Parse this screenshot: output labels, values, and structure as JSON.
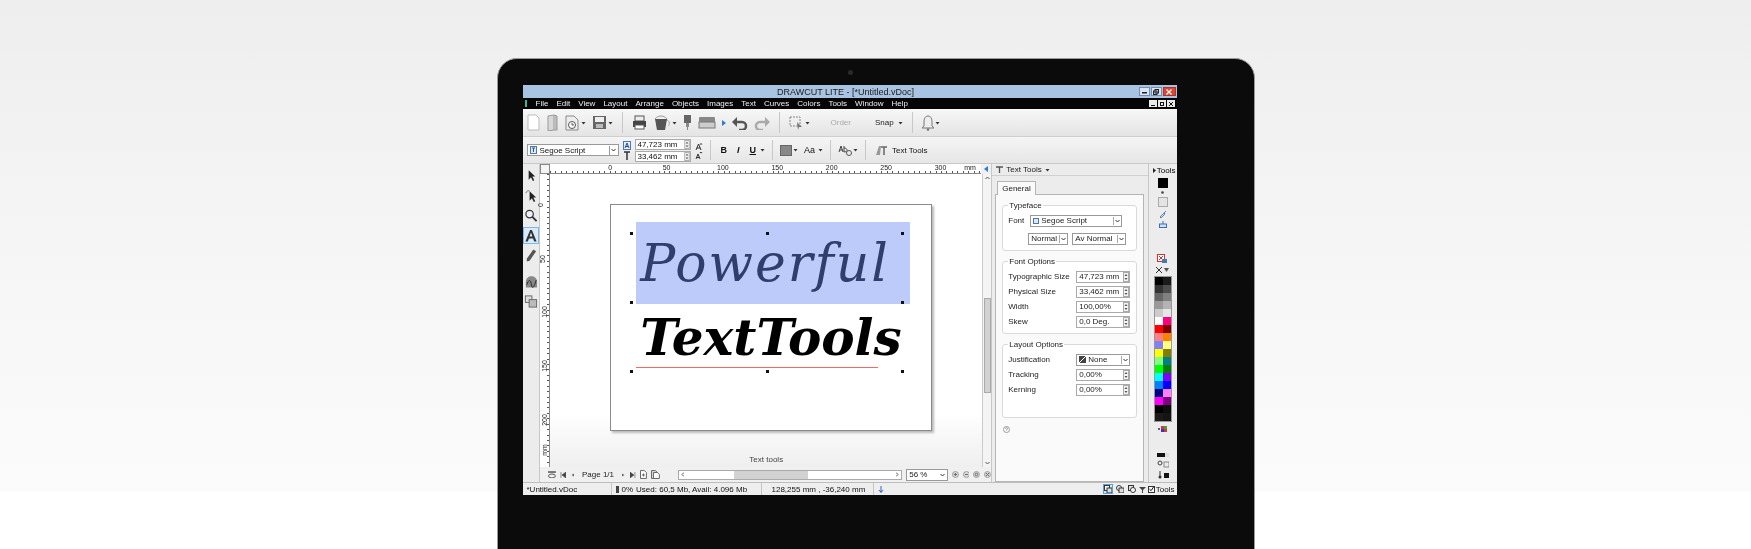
{
  "window": {
    "title": "DRAWCUT LITE - [*Untitled.vDoc]"
  },
  "menu": [
    "File",
    "Edit",
    "View",
    "Layout",
    "Arrange",
    "Objects",
    "Images",
    "Text",
    "Curves",
    "Colors",
    "Tools",
    "Window",
    "Help"
  ],
  "toolbar": {
    "order": {
      "label": "Order",
      "disabled": true
    },
    "snap": {
      "label": "Snap",
      "disabled": false
    }
  },
  "text_toolbar": {
    "font": "Segoe Script",
    "typographic_size": "47,723 mm",
    "physical_size": "33,462 mm",
    "bold": "B",
    "italic": "I",
    "underline": "U",
    "case": "Aa",
    "text_tools": "Text Tools"
  },
  "tools": [
    {
      "kind": "pointer",
      "selected": false
    },
    {
      "kind": "shape",
      "selected": false
    },
    {
      "kind": "zoom",
      "selected": false
    },
    {
      "kind": "text",
      "selected": true
    },
    {
      "kind": "pen",
      "selected": false
    },
    {
      "kind": "fill",
      "selected": false
    },
    {
      "kind": "arrange",
      "selected": false
    }
  ],
  "rulers": {
    "horizontal": [
      "0",
      "50",
      "100",
      "150",
      "200",
      "250",
      "300",
      "mm"
    ],
    "vertical": [
      "0",
      "50",
      "100",
      "150",
      "200",
      "mm"
    ]
  },
  "document": {
    "lines": [
      {
        "text": "Powerful",
        "selected": true,
        "misspelled": false
      },
      {
        "text": "TextTools",
        "selected": false,
        "misspelled": true
      }
    ]
  },
  "canvas_caption": "Text tools",
  "navigation": {
    "page": "Page 1/1",
    "zoom": "56 %"
  },
  "docker": {
    "title": "Text Tools",
    "tabs": [
      {
        "label": "General",
        "selected": true
      }
    ],
    "groups": [
      {
        "title": "Typeface",
        "rows": [
          {
            "kind": "select",
            "label": "Font",
            "value": "Segoe Script"
          },
          {
            "kind": "select_pair",
            "values": [
              "Normal",
              "Av Normal"
            ]
          }
        ]
      },
      {
        "title": "Font Options",
        "rows": [
          {
            "kind": "spin",
            "label": "Typographic Size",
            "value": "47,723 mm"
          },
          {
            "kind": "spin",
            "label": "Physical Size",
            "value": "33,462 mm"
          },
          {
            "kind": "spin",
            "label": "Width",
            "value": "100,00%"
          },
          {
            "kind": "spin",
            "label": "Skew",
            "value": "0,0 Deg."
          }
        ]
      },
      {
        "title": "Layout Options",
        "rows": [
          {
            "kind": "select",
            "label": "Justification",
            "value": "None"
          },
          {
            "kind": "spin",
            "label": "Tracking",
            "value": "0,00%"
          },
          {
            "kind": "spin",
            "label": "Kerning",
            "value": "0,00%"
          }
        ]
      }
    ]
  },
  "palette_header": "Tools",
  "palette": [
    {
      "color": "#000000"
    },
    {
      "color": "#1a1a1a"
    },
    {
      "color": "#333333"
    },
    {
      "color": "#4d4d4d"
    },
    {
      "color": "#666666"
    },
    {
      "color": "#808080"
    },
    {
      "color": "#999999"
    },
    {
      "color": "#b3b3b3"
    },
    {
      "color": "#cccccc"
    },
    {
      "color": "#e6e6e6"
    },
    {
      "color": "#ffffff"
    },
    {
      "color": "#ff0080"
    },
    {
      "color": "#ff0000"
    },
    {
      "color": "#800000"
    },
    {
      "color": "#ff8080"
    },
    {
      "color": "#ff8000"
    },
    {
      "color": "#8080ff"
    },
    {
      "color": "#ffff80"
    },
    {
      "color": "#ffff00"
    },
    {
      "color": "#808000"
    },
    {
      "color": "#80ff80"
    },
    {
      "color": "#008080"
    },
    {
      "color": "#00ff00"
    },
    {
      "color": "#008000"
    },
    {
      "color": "#00ffff"
    },
    {
      "color": "#8000ff"
    },
    {
      "color": "#0080ff"
    },
    {
      "color": "#0000ff"
    },
    {
      "color": "#000080"
    },
    {
      "color": "#ff80ff"
    },
    {
      "color": "#ff00ff"
    },
    {
      "color": "#800080"
    },
    {
      "color": "#000000"
    },
    {
      "color": "#0d0d0d"
    },
    {
      "color": "#1a1a1a"
    },
    {
      "color": "#141414"
    }
  ],
  "status_bar": {
    "file": "*Untitled.vDoc",
    "memory_percent": "0%",
    "memory": "Used: 60,5 Mb, Avail: 4.096 Mb",
    "position": "128,255 mm , -36,240 mm",
    "view_buttons": [
      {
        "selected": true
      },
      {
        "selected": false
      },
      {
        "selected": false
      }
    ],
    "tools": {
      "label": "Tools",
      "checked": true
    }
  }
}
